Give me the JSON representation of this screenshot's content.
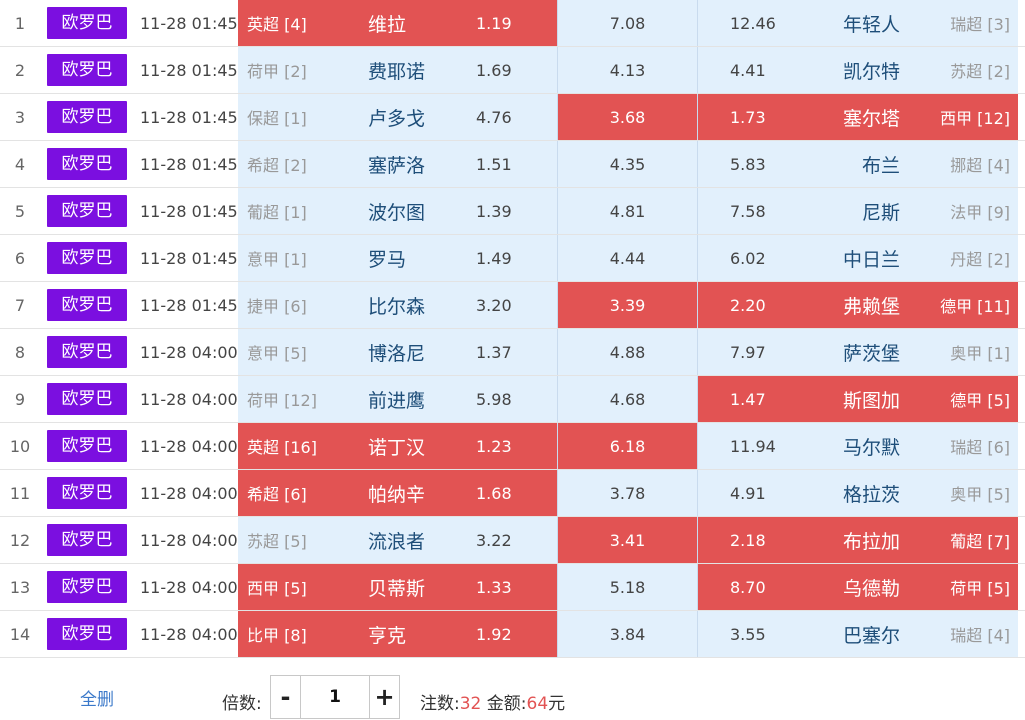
{
  "colors": {
    "tag_bg": "#7b0fe0",
    "selected_bg": "#e25353",
    "cell_bg": "#e2f0fc",
    "team_text": "#1e4e79"
  },
  "matches": [
    {
      "num": "1",
      "comp": "欧罗巴",
      "time": "11-28 01:45",
      "home_league": "英超 [4]",
      "home_team": "维拉",
      "home_odds": "1.19",
      "draw_odds": "7.08",
      "away_odds": "12.46",
      "away_team": "年轻人",
      "away_league": "瑞超 [3]",
      "home_sel": true,
      "draw_sel": false,
      "away_sel": false
    },
    {
      "num": "2",
      "comp": "欧罗巴",
      "time": "11-28 01:45",
      "home_league": "荷甲 [2]",
      "home_team": "费耶诺",
      "home_odds": "1.69",
      "draw_odds": "4.13",
      "away_odds": "4.41",
      "away_team": "凯尔特",
      "away_league": "苏超 [2]",
      "home_sel": false,
      "draw_sel": false,
      "away_sel": false
    },
    {
      "num": "3",
      "comp": "欧罗巴",
      "time": "11-28 01:45",
      "home_league": "保超 [1]",
      "home_team": "卢多戈",
      "home_odds": "4.76",
      "draw_odds": "3.68",
      "away_odds": "1.73",
      "away_team": "塞尔塔",
      "away_league": "西甲 [12]",
      "home_sel": false,
      "draw_sel": true,
      "away_sel": true
    },
    {
      "num": "4",
      "comp": "欧罗巴",
      "time": "11-28 01:45",
      "home_league": "希超 [2]",
      "home_team": "塞萨洛",
      "home_odds": "1.51",
      "draw_odds": "4.35",
      "away_odds": "5.83",
      "away_team": "布兰",
      "away_league": "挪超 [4]",
      "home_sel": false,
      "draw_sel": false,
      "away_sel": false
    },
    {
      "num": "5",
      "comp": "欧罗巴",
      "time": "11-28 01:45",
      "home_league": "葡超 [1]",
      "home_team": "波尔图",
      "home_odds": "1.39",
      "draw_odds": "4.81",
      "away_odds": "7.58",
      "away_team": "尼斯",
      "away_league": "法甲 [9]",
      "home_sel": false,
      "draw_sel": false,
      "away_sel": false
    },
    {
      "num": "6",
      "comp": "欧罗巴",
      "time": "11-28 01:45",
      "home_league": "意甲 [1]",
      "home_team": "罗马",
      "home_odds": "1.49",
      "draw_odds": "4.44",
      "away_odds": "6.02",
      "away_team": "中日兰",
      "away_league": "丹超 [2]",
      "home_sel": false,
      "draw_sel": false,
      "away_sel": false
    },
    {
      "num": "7",
      "comp": "欧罗巴",
      "time": "11-28 01:45",
      "home_league": "捷甲 [6]",
      "home_team": "比尔森",
      "home_odds": "3.20",
      "draw_odds": "3.39",
      "away_odds": "2.20",
      "away_team": "弗赖堡",
      "away_league": "德甲 [11]",
      "home_sel": false,
      "draw_sel": true,
      "away_sel": true
    },
    {
      "num": "8",
      "comp": "欧罗巴",
      "time": "11-28 04:00",
      "home_league": "意甲 [5]",
      "home_team": "博洛尼",
      "home_odds": "1.37",
      "draw_odds": "4.88",
      "away_odds": "7.97",
      "away_team": "萨茨堡",
      "away_league": "奥甲 [1]",
      "home_sel": false,
      "draw_sel": false,
      "away_sel": false
    },
    {
      "num": "9",
      "comp": "欧罗巴",
      "time": "11-28 04:00",
      "home_league": "荷甲 [12]",
      "home_team": "前进鹰",
      "home_odds": "5.98",
      "draw_odds": "4.68",
      "away_odds": "1.47",
      "away_team": "斯图加",
      "away_league": "德甲 [5]",
      "home_sel": false,
      "draw_sel": false,
      "away_sel": true
    },
    {
      "num": "10",
      "comp": "欧罗巴",
      "time": "11-28 04:00",
      "home_league": "英超 [16]",
      "home_team": "诺丁汉",
      "home_odds": "1.23",
      "draw_odds": "6.18",
      "away_odds": "11.94",
      "away_team": "马尔默",
      "away_league": "瑞超 [6]",
      "home_sel": true,
      "draw_sel": true,
      "away_sel": false
    },
    {
      "num": "11",
      "comp": "欧罗巴",
      "time": "11-28 04:00",
      "home_league": "希超 [6]",
      "home_team": "帕纳辛",
      "home_odds": "1.68",
      "draw_odds": "3.78",
      "away_odds": "4.91",
      "away_team": "格拉茨",
      "away_league": "奥甲 [5]",
      "home_sel": true,
      "draw_sel": false,
      "away_sel": false
    },
    {
      "num": "12",
      "comp": "欧罗巴",
      "time": "11-28 04:00",
      "home_league": "苏超 [5]",
      "home_team": "流浪者",
      "home_odds": "3.22",
      "draw_odds": "3.41",
      "away_odds": "2.18",
      "away_team": "布拉加",
      "away_league": "葡超 [7]",
      "home_sel": false,
      "draw_sel": true,
      "away_sel": true
    },
    {
      "num": "13",
      "comp": "欧罗巴",
      "time": "11-28 04:00",
      "home_league": "西甲 [5]",
      "home_team": "贝蒂斯",
      "home_odds": "1.33",
      "draw_odds": "5.18",
      "away_odds": "8.70",
      "away_team": "乌德勒",
      "away_league": "荷甲 [5]",
      "home_sel": true,
      "draw_sel": false,
      "away_sel": true
    },
    {
      "num": "14",
      "comp": "欧罗巴",
      "time": "11-28 04:00",
      "home_league": "比甲 [8]",
      "home_team": "亨克",
      "home_odds": "1.92",
      "draw_odds": "3.84",
      "away_odds": "3.55",
      "away_team": "巴塞尔",
      "away_league": "瑞超 [4]",
      "home_sel": true,
      "draw_sel": false,
      "away_sel": false
    }
  ],
  "footer": {
    "clear_all": "全删",
    "multiplier_label": "倍数:",
    "minus": "-",
    "plus": "+",
    "multiplier_value": "1",
    "bets_label": "注数:",
    "bets_value": "32",
    "amount_label": "金额:",
    "amount_value": "64",
    "amount_unit": "元"
  }
}
